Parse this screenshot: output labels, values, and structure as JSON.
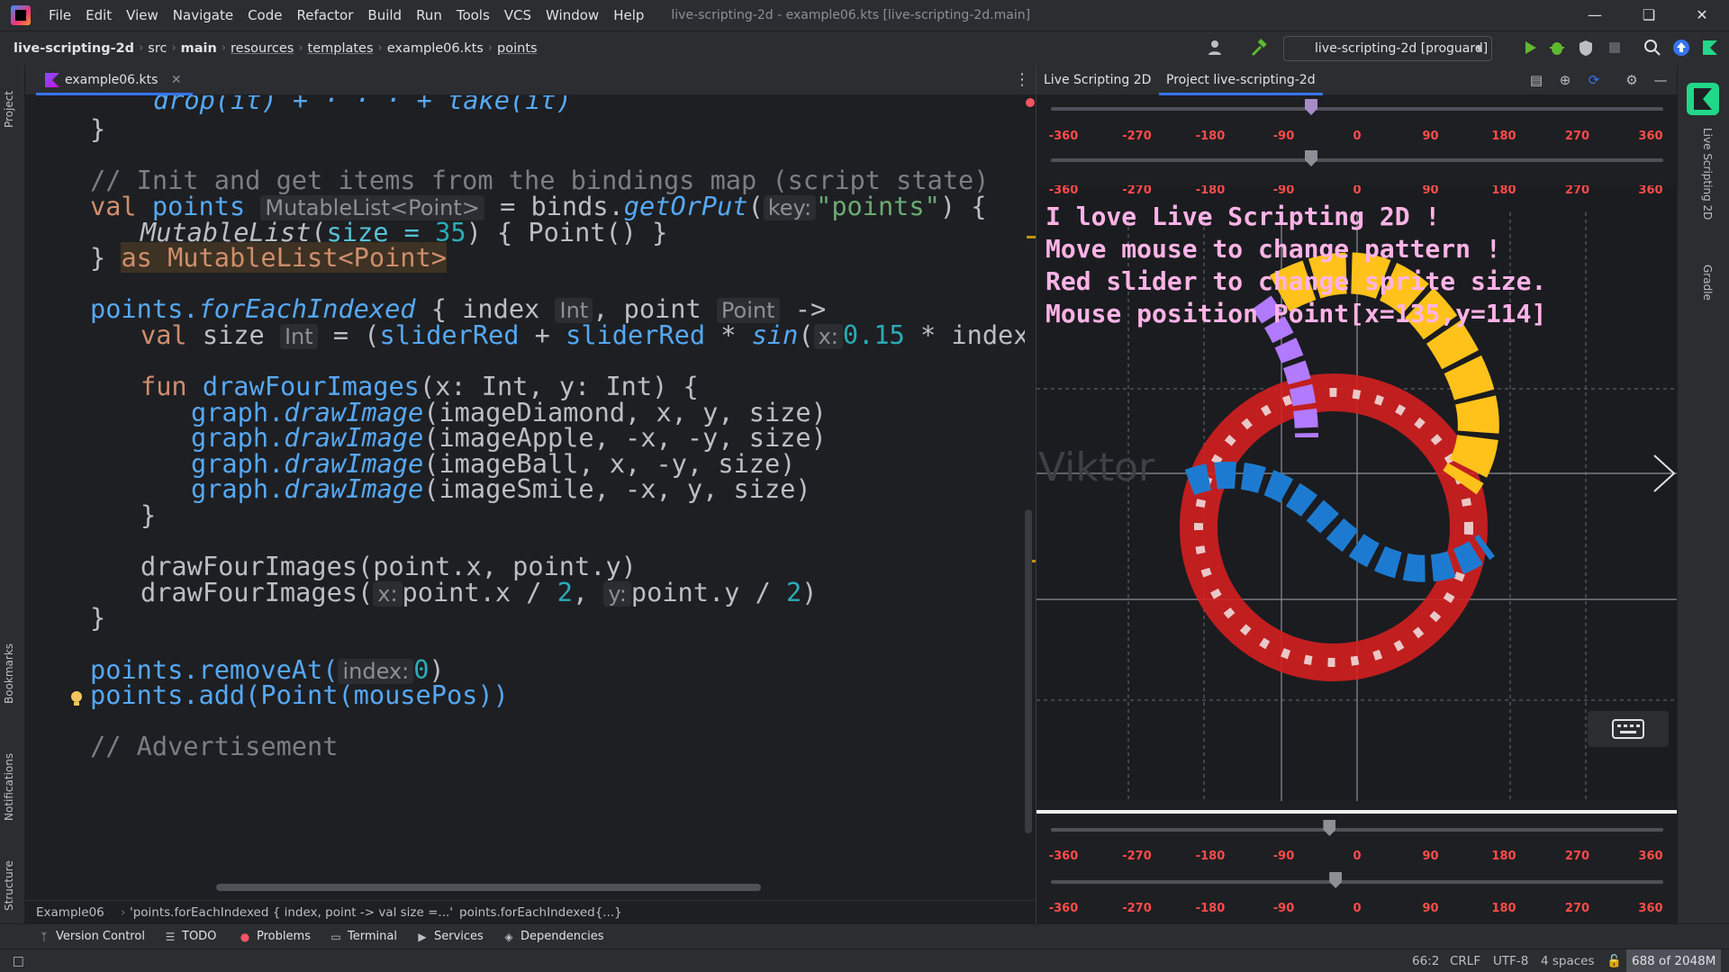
{
  "menubar": {
    "items": [
      "File",
      "Edit",
      "View",
      "Navigate",
      "Code",
      "Refactor",
      "Build",
      "Run",
      "Tools",
      "VCS",
      "Window",
      "Help"
    ],
    "title": "live-scripting-2d - example06.kts [live-scripting-2d.main]"
  },
  "breadcrumbs": [
    "live-scripting-2d",
    "src",
    "main",
    "resources",
    "templates",
    "example06.kts",
    "points"
  ],
  "run_config": "live-scripting-2d [proguard]",
  "left_strip": {
    "project": "Project",
    "bookmarks": "Bookmarks",
    "notifications": "Notifications",
    "structure": "Structure"
  },
  "editor": {
    "tab": "example06.kts",
    "code": {
      "l0": "drop(it) + · · · + take(it)",
      "l1": "}",
      "l2": "// Init and get items from the bindings map (script state)",
      "l3a": "val",
      "l3b": "points",
      "l3h": "MutableList<Point>",
      "l3c": " = binds.",
      "l3d": "getOrPut",
      "l3e": "(",
      "l3k": "key:",
      "l3s": "\"points\"",
      "l3f": ") {",
      "l4a": "MutableList",
      "l4b": "(",
      "l4c": "size",
      "l4d": " = ",
      "l4e": "35",
      "l4f": ") { Point() }",
      "l5a": "} ",
      "l5b": "as MutableList<Point>",
      "l6a": "points.",
      "l6b": "forEachIndexed",
      "l6c": " { index",
      "l6h1": "Int",
      "l6d": ", point",
      "l6h2": "Point",
      "l6e": " ->",
      "l7a": "val",
      "l7b": " size",
      "l7h": "Int",
      "l7c": " = (",
      "l7d": "sliderRed",
      "l7e": " + ",
      "l7f": "sliderRed",
      "l7g": " * ",
      "l7i": "sin",
      "l7j": "(",
      "l7k": "x:",
      "l7n": "0.15",
      "l7o": " * index",
      "l8a": "fun",
      "l8b": " drawFourImages",
      "l8c": "(x: Int, y: Int) {",
      "l9a": "graph.",
      "l9b": "drawImage",
      "l9c": "(imageDiamond, x, y, size)",
      "l10a": "graph.",
      "l10b": "drawImage",
      "l10c": "(imageApple, -x, -y, size)",
      "l11a": "graph.",
      "l11b": "drawImage",
      "l11c": "(imageBall, x, -y, size)",
      "l12a": "graph.",
      "l12b": "drawImage",
      "l12c": "(imageSmile, -x, y, size)",
      "l13": "}",
      "l14": "drawFourImages(point.x, point.y)",
      "l15a": "drawFourImages(",
      "l15k1": "x:",
      "l15b": "point.x / ",
      "l15n1": "2",
      "l15c": ", ",
      "l15k2": "y:",
      "l15d": "point.y / ",
      "l15n2": "2",
      "l15e": ")",
      "l16": "}",
      "l17a": "points.removeAt(",
      "l17k": "index:",
      "l17n": "0",
      "l17b": ")",
      "l18": "points.add(Point(mousePos))",
      "l19": "// Advertisement"
    },
    "status_crumbs": [
      "Example06",
      "'points.forEachIndexed { index, point -> val size =...'",
      "points.forEachIndexed{...}"
    ]
  },
  "panel": {
    "tabs": [
      "Live Scripting 2D",
      "Project live-scripting-2d"
    ],
    "ticks": [
      "-360",
      "-270",
      "-180",
      "-90",
      "0",
      "90",
      "180",
      "270",
      "360"
    ],
    "sliders": {
      "top1": 0.425,
      "top2": 0.425,
      "bottom1": 0.455,
      "bottom2": 0.465
    },
    "canvas_lines": [
      "I love Live Scripting 2D ! ",
      "Move mouse to change pattern !",
      "Red slider to change sprite size.",
      "Mouse position Point[x=135,y=114]"
    ],
    "watermark": "Viktor"
  },
  "right_strip": {
    "live": "Live Scripting 2D",
    "gradle": "Gradle"
  },
  "toolwindows": [
    "Version Control",
    "TODO",
    "Problems",
    "Terminal",
    "Services",
    "Dependencies"
  ],
  "status": {
    "pos": "66:2",
    "eol": "CRLF",
    "enc": "UTF-8",
    "indent": "4 spaces",
    "mem": "688 of 2048M"
  },
  "colors": {
    "accent": "#3574f0",
    "tick_red": "#ff4b4b",
    "canvas_text": "#ffb3e6"
  }
}
